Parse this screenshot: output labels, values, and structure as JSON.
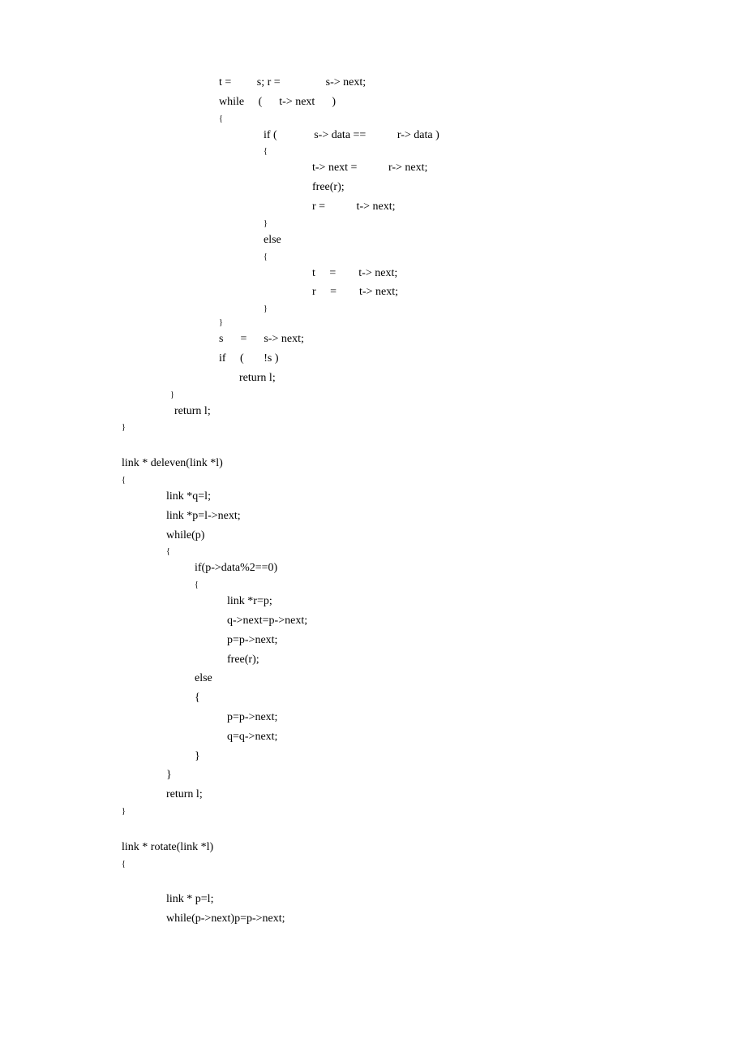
{
  "code": {
    "lines": [
      {
        "indent": 120,
        "text": "t =         s; r =                s-> next;"
      },
      {
        "indent": 120,
        "text": "while     (      t-> next      )"
      },
      {
        "indent": 120,
        "text": "{",
        "small": true
      },
      {
        "indent": 175,
        "text": "if (             s-> data ==           r-> data )"
      },
      {
        "indent": 175,
        "text": "{",
        "small": true
      },
      {
        "indent": 235,
        "text": "t-> next =           r-> next;"
      },
      {
        "indent": 235,
        "text": "free(r);"
      },
      {
        "indent": 235,
        "text": "r =           t-> next;"
      },
      {
        "indent": 175,
        "text": "}",
        "small": true
      },
      {
        "indent": 175,
        "text": "else"
      },
      {
        "indent": 175,
        "text": "{",
        "small": true
      },
      {
        "indent": 235,
        "text": "t     =        t-> next;"
      },
      {
        "indent": 235,
        "text": "r     =        t-> next;"
      },
      {
        "indent": 175,
        "text": "}",
        "small": true
      },
      {
        "indent": 120,
        "text": "}",
        "small": true
      },
      {
        "indent": 120,
        "text": "s      =      s-> next;"
      },
      {
        "indent": 120,
        "text": "if     (       !s )"
      },
      {
        "indent": 145,
        "text": "return l;"
      },
      {
        "indent": 60,
        "text": "}",
        "small": true
      },
      {
        "indent": 65,
        "text": "return l;"
      },
      {
        "indent": 0,
        "text": "}",
        "small": true
      },
      {
        "indent": 0,
        "text": ""
      },
      {
        "indent": 0,
        "text": "link * deleven(link *l)"
      },
      {
        "indent": 0,
        "text": "{",
        "small": true
      },
      {
        "indent": 55,
        "text": "link *q=l;"
      },
      {
        "indent": 55,
        "text": "link *p=l->next;"
      },
      {
        "indent": 55,
        "text": "while(p)"
      },
      {
        "indent": 55,
        "text": "{",
        "small": true
      },
      {
        "indent": 90,
        "text": "if(p->data%2==0)"
      },
      {
        "indent": 90,
        "text": "{",
        "small": true
      },
      {
        "indent": 130,
        "text": "link *r=p;"
      },
      {
        "indent": 130,
        "text": "q->next=p->next;"
      },
      {
        "indent": 130,
        "text": "p=p->next;"
      },
      {
        "indent": 130,
        "text": "free(r);"
      },
      {
        "indent": 90,
        "text": "else"
      },
      {
        "indent": 90,
        "text": "{"
      },
      {
        "indent": 130,
        "text": "p=p->next;"
      },
      {
        "indent": 130,
        "text": "q=q->next;"
      },
      {
        "indent": 90,
        "text": "}"
      },
      {
        "indent": 55,
        "text": "}"
      },
      {
        "indent": 55,
        "text": "return l;"
      },
      {
        "indent": 0,
        "text": "}",
        "small": true
      },
      {
        "indent": 0,
        "text": ""
      },
      {
        "indent": 0,
        "text": "link * rotate(link *l)"
      },
      {
        "indent": 0,
        "text": "{",
        "small": true
      },
      {
        "indent": 0,
        "text": ""
      },
      {
        "indent": 55,
        "text": "link * p=l;"
      },
      {
        "indent": 55,
        "text": "while(p->next)p=p->next;"
      }
    ]
  }
}
